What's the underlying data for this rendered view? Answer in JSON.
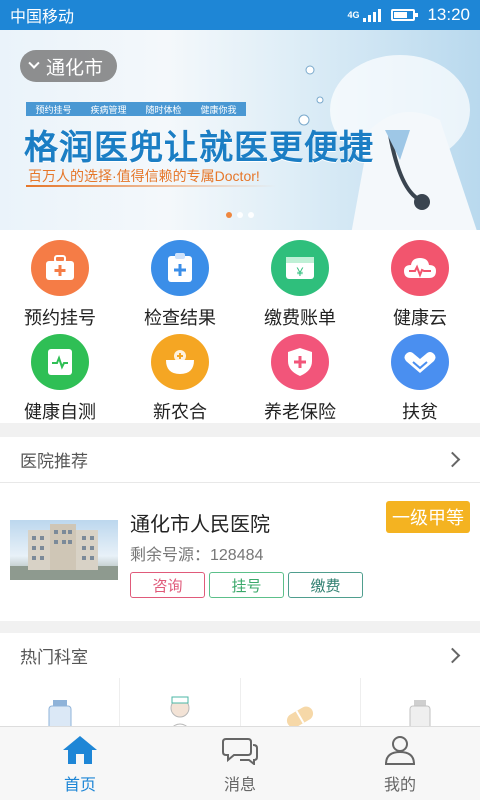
{
  "status_bar": {
    "carrier": "中国移动",
    "network": "4G",
    "time": "13:20"
  },
  "banner": {
    "city": "通化市",
    "tags": [
      "预约挂号",
      "疾病管理",
      "随时体检",
      "健康你我"
    ],
    "title": "格润医兜让就医更便捷",
    "subtitle": "百万人的选择·值得信赖的专属Doctor!"
  },
  "services": [
    {
      "label": "预约挂号",
      "icon": "medical-kit-icon",
      "color": "#f57c46"
    },
    {
      "label": "检查结果",
      "icon": "clipboard-icon",
      "color": "#3b8ee8"
    },
    {
      "label": "缴费账单",
      "icon": "bill-icon",
      "color": "#2fbf7c"
    },
    {
      "label": "健康云",
      "icon": "heart-cloud-icon",
      "color": "#f2556e"
    },
    {
      "label": "健康自测",
      "icon": "self-test-icon",
      "color": "#2fbf55"
    },
    {
      "label": "新农合",
      "icon": "insurance-bowl-icon",
      "color": "#f5a623"
    },
    {
      "label": "养老保险",
      "icon": "shield-icon",
      "color": "#f2557a"
    },
    {
      "label": "扶贫",
      "icon": "handshake-icon",
      "color": "#4a8ff0"
    }
  ],
  "hospital_section": {
    "title": "医院推荐"
  },
  "hospital": {
    "name": "通化市人民医院",
    "remaining": "剩余号源：128484",
    "level": "一级甲等",
    "buttons": {
      "consult": "咨询",
      "register": "挂号",
      "pay": "缴费"
    }
  },
  "dept_section": {
    "title": "热门科室"
  },
  "tabs": [
    {
      "label": "首页",
      "icon": "home-icon",
      "active": true
    },
    {
      "label": "消息",
      "icon": "chat-icon",
      "active": false
    },
    {
      "label": "我的",
      "icon": "user-icon",
      "active": false
    }
  ]
}
